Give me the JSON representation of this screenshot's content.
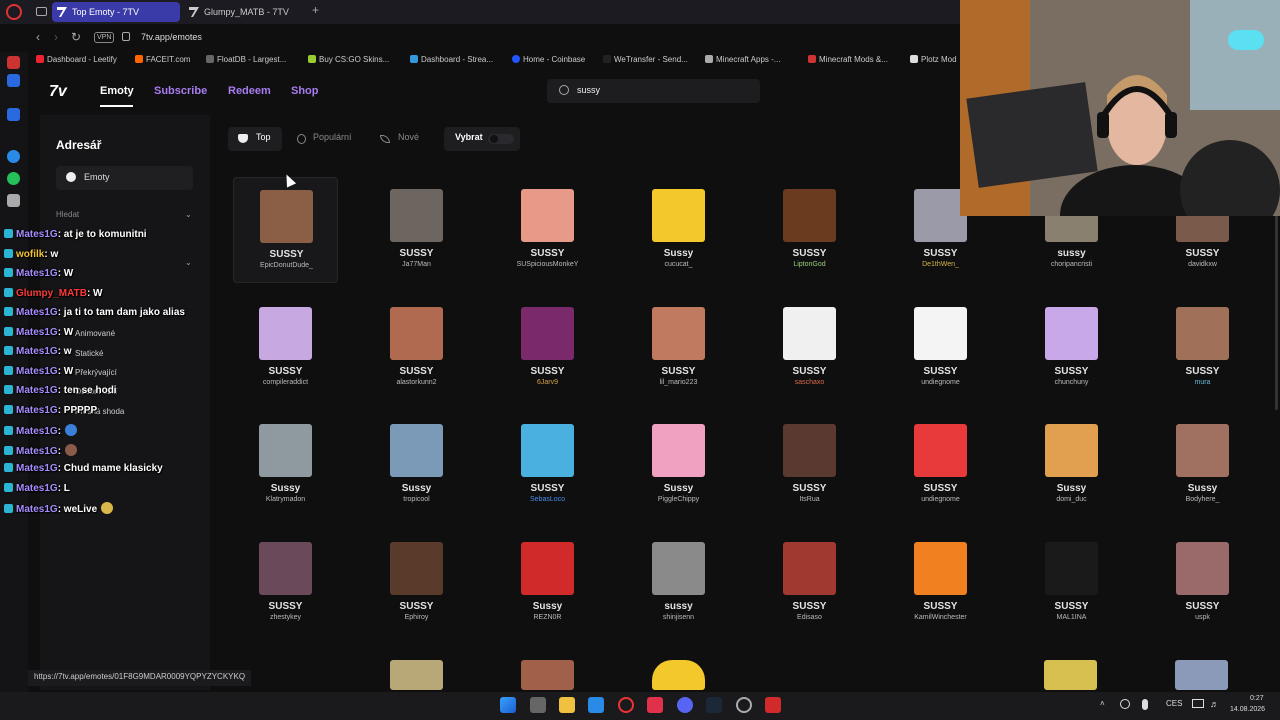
{
  "browser": {
    "tabs": [
      {
        "label": "Top Emoty - 7TV"
      },
      {
        "label": "Glumpy_MATB - 7TV"
      }
    ],
    "new_tab": "+",
    "vpn": "VPN",
    "url": "7tv.app/emotes",
    "bookmarks": [
      "Dashboard - Leetify",
      "FACEIT.com",
      "FloatDB - Largest...",
      "Buy CS:GO Skins...",
      "Dashboard - Strea...",
      "Home - Coinbase",
      "WeTransfer - Send...",
      "Minecraft Apps -...",
      "Minecraft Mods &...",
      "Plotz Mod"
    ],
    "status_url": "https://7tv.app/emotes/01F8G9MDAR0009YQPYZYCKYKQ"
  },
  "site": {
    "logo": "7v",
    "nav": [
      "Emoty",
      "Subscribe",
      "Redeem",
      "Shop"
    ],
    "search_value": "sussy"
  },
  "sidebar": {
    "title": "Adresář",
    "emoty": "Emoty",
    "hledat": "Hledat",
    "filters": [
      "Animované",
      "Statické",
      "Překrývající",
      "Osobní užití",
      "Přesná shoda"
    ]
  },
  "filters": {
    "top": "Top",
    "popular": "Populární",
    "new": "Nové",
    "select": "Vybrat"
  },
  "chat": [
    {
      "user": "Mates1G",
      "msg": ": at je to komunitni",
      "color": "purple"
    },
    {
      "user": "wofilk",
      "msg": ": w",
      "color": "yellow"
    },
    {
      "user": "Mates1G",
      "msg": ": W",
      "color": "purple"
    },
    {
      "user": "Glumpy_MATB",
      "msg": ": W",
      "color": "red"
    },
    {
      "user": "Mates1G",
      "msg": ": ja ti to tam dam jako alias",
      "color": "purple"
    },
    {
      "user": "Mates1G",
      "msg": ": W",
      "color": "purple"
    },
    {
      "user": "Mates1G",
      "msg": ": w",
      "color": "purple"
    },
    {
      "user": "Mates1G",
      "msg": ": W",
      "color": "purple"
    },
    {
      "user": "Mates1G",
      "msg": ": ten se hodi",
      "color": "purple"
    },
    {
      "user": "Mates1G",
      "msg": ": PPPPP",
      "color": "purple"
    },
    {
      "user": "Mates1G",
      "msg": ":",
      "color": "purple",
      "emote": "#3a7fd8"
    },
    {
      "user": "Mates1G",
      "msg": ":",
      "color": "purple",
      "emote": "#8a5a4a"
    },
    {
      "user": "Mates1G",
      "msg": ": Chud mame klasicky",
      "color": "purple"
    },
    {
      "user": "Mates1G",
      "msg": ": L",
      "color": "purple"
    },
    {
      "user": "Mates1G",
      "msg": ":  weLive",
      "color": "purple",
      "emote": "#d8b84a"
    }
  ],
  "emotes": [
    {
      "name": "SUSSY",
      "author": "EpicDonutDude_",
      "color": "#8a5f45"
    },
    {
      "name": "SUSSY",
      "author": "Ja77Man",
      "color": "#6d6660"
    },
    {
      "name": "SUSSY",
      "author": "SUSpiciousMonkeY",
      "color": "#e89a88"
    },
    {
      "name": "Sussy",
      "author": "cucucat_",
      "color": "#f2c82a"
    },
    {
      "name": "SUSSY",
      "author": "LiptonGod",
      "author_color": "#9acd7a",
      "color": "#6a3b1e"
    },
    {
      "name": "SUSSY",
      "author": "De1thWen_",
      "author_color": "#d9b44a",
      "color": "#9a9aa8"
    },
    {
      "name": "sussy",
      "author": "choripancristi",
      "color": "#8a8070"
    },
    {
      "name": "SUSSY",
      "author": "davidkxw",
      "color": "#7a5a4a"
    },
    {
      "name": "SUSSY",
      "author": "compileraddict",
      "color": "#c7a8e0"
    },
    {
      "name": "SUSSY",
      "author": "alastorkunn2",
      "color": "#b06a50"
    },
    {
      "name": "SUSSY",
      "author": "6Jarv9",
      "author_color": "#d9a04a",
      "color": "#7a2a6a"
    },
    {
      "name": "SUSSY",
      "author": "lil_mario223",
      "color": "#c07a60"
    },
    {
      "name": "SUSSY",
      "author": "saschaxo",
      "author_color": "#d96a4a",
      "color": "#f0f0f0"
    },
    {
      "name": "SUSSY",
      "author": "undiegnome",
      "color": "#f4f4f4"
    },
    {
      "name": "SUSSY",
      "author": "chunchuny",
      "color": "#c8a8e8"
    },
    {
      "name": "SUSSY",
      "author": "mura",
      "author_color": "#6ab8d8",
      "color": "#a07058"
    },
    {
      "name": "Sussy",
      "author": "Klatrymadon",
      "color": "#8f9aa0"
    },
    {
      "name": "Sussy",
      "author": "tropicool",
      "color": "#7a9ab8"
    },
    {
      "name": "SUSSY",
      "author": "SebasLoco",
      "author_color": "#4a8ae8",
      "color": "#4ab0e0"
    },
    {
      "name": "Sussy",
      "author": "PiggleChippy",
      "color": "#f0a0c0"
    },
    {
      "name": "SUSSY",
      "author": "ItsRua",
      "color": "#5a3a30"
    },
    {
      "name": "SUSSY",
      "author": "undiegnome",
      "color": "#e83a3a"
    },
    {
      "name": "Sussy",
      "author": "domi_duc",
      "color": "#e0a050"
    },
    {
      "name": "Sussy",
      "author": "Bodyhere_",
      "color": "#a07060"
    },
    {
      "name": "SUSSY",
      "author": "zhestykey",
      "color": "#6a4a5a"
    },
    {
      "name": "SUSSY",
      "author": "Ephiroy",
      "color": "#5a3a2a"
    },
    {
      "name": "Sussy",
      "author": "REZN0R",
      "color": "#d02a2a"
    },
    {
      "name": "sussy",
      "author": "shinjisenn",
      "color": "#8a8a8a"
    },
    {
      "name": "SUSSY",
      "author": "Edisaso",
      "color": "#a03a30"
    },
    {
      "name": "SUSSY",
      "author": "KamilWinchester",
      "color": "#f08020"
    },
    {
      "name": "SUSSY",
      "author": "MAL1INA",
      "color": "#1a1a1a"
    },
    {
      "name": "SUSSY",
      "author": "uspk",
      "color": "#9a6a6a"
    }
  ],
  "taskbar": {
    "lang": "CES",
    "time": "0:27",
    "date": "14.08.2026"
  }
}
